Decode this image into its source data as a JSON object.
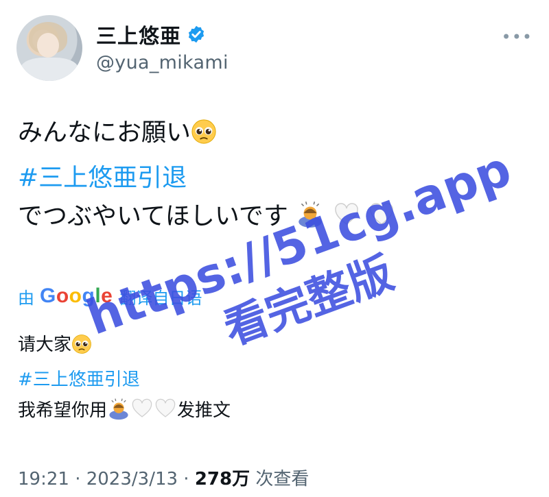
{
  "profile": {
    "display_name": "三上悠亜",
    "handle": "@yua_mikami",
    "more_glyph": "•••"
  },
  "tweet": {
    "line1": "みんなにお願い",
    "hashtag": "#三上悠亜引退",
    "line3": "でつぶやいてほしいです"
  },
  "translation": {
    "prefix": "由",
    "brand": [
      "G",
      "o",
      "o",
      "g",
      "l",
      "e"
    ],
    "suffix": "翻译自日语",
    "line1": "请大家",
    "hashtag": "#三上悠亜引退",
    "line3a": "我希望你用",
    "line3b": "发推文"
  },
  "meta": {
    "time": "19:21 · 2023/3/13 · ",
    "views_count": "278万",
    "views_label": " 次查看"
  },
  "watermark": {
    "url": "https://51cg.app",
    "text": "看完整版"
  },
  "icons": {
    "verified": "verified-badge-icon",
    "pleading": "pleading-face-icon",
    "bowing": "bowing-person-icon",
    "heart": "white-heart-icon"
  },
  "colors": {
    "accent": "#1d9bf0",
    "secondary": "#536471",
    "watermark": "#3d4fe0"
  }
}
